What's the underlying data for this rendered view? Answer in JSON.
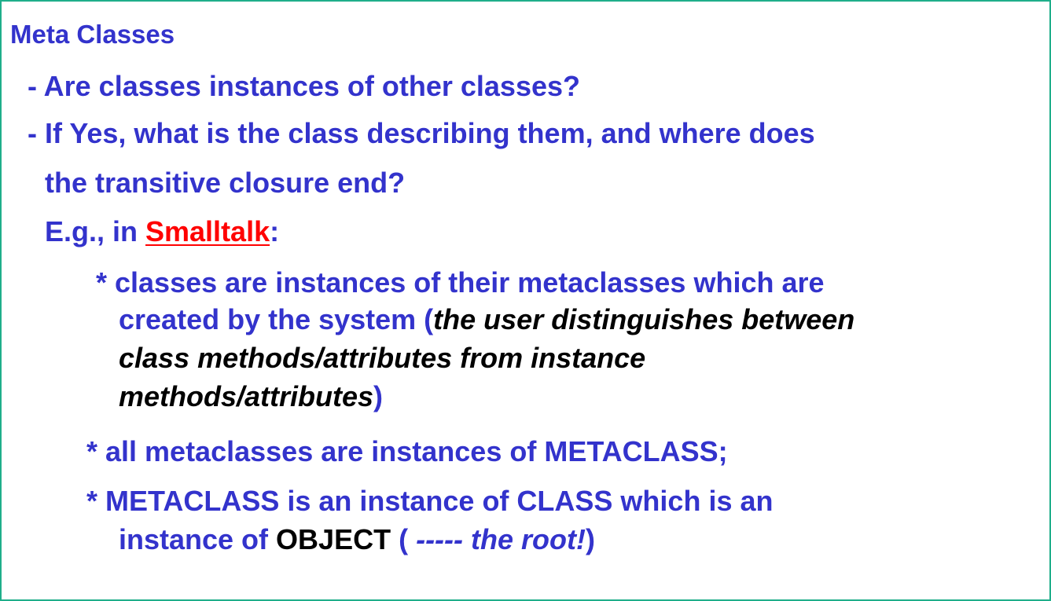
{
  "slide": {
    "title": "Meta Classes",
    "bullet1": "- Are classes instances of other classes?",
    "bullet2_line1": "- If Yes, what is the class describing them, and where does",
    "bullet2_line2": "the transitive closure end?",
    "example_prefix": "E.g., in ",
    "example_link": "Smalltalk",
    "example_suffix": ":",
    "sub1_line1": "* classes are instances of their metaclasses which are",
    "sub1_line2_plain": "created by the system (",
    "sub1_line2_italic": "the user distinguishes between",
    "sub1_line3_italic": "class methods/attributes from instance",
    "sub1_line4_italic": "methods/attributes",
    "sub1_line4_close": ")",
    "sub2": "* all metaclasses are instances of METACLASS;",
    "sub3_line1": "* METACLASS is an instance of CLASS which is an",
    "sub3_line2_prefix": "instance of ",
    "sub3_line2_object": "OBJECT",
    "sub3_line2_paren": " ( ",
    "sub3_line2_italic": "----- the root!",
    "sub3_line2_close": ")"
  },
  "colors": {
    "text_blue": "#3333cc",
    "link_red": "#ff0000",
    "emphasis_black": "#000000",
    "border_green": "#1fae8a"
  }
}
